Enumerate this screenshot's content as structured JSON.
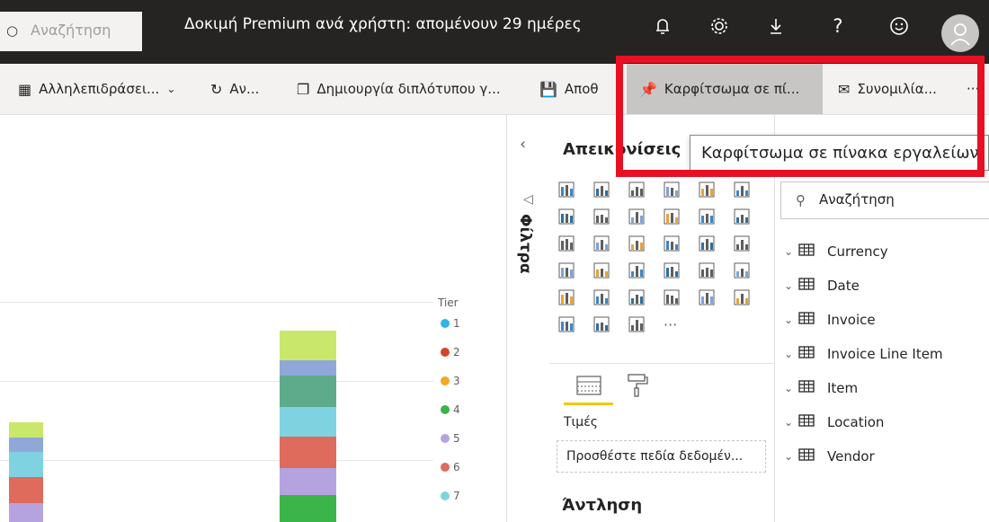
{
  "topbar": {
    "search_placeholder": "Αναζήτηση",
    "trial_text": "Δοκιμή Premium ανά χρήστη: απομένουν 29 ημέρες",
    "icons": [
      "bell-icon",
      "gear-icon",
      "download-icon",
      "help-icon",
      "smiley-icon"
    ]
  },
  "toolbar": {
    "interactions": "Αλληλεπιδράσει...",
    "refresh": "Αν...",
    "duplicate": "Δημιουργία διπλότυπου γ...",
    "save": "Αποθ",
    "pin": "Καρφίτσωμα σε πί...",
    "chat": "Συνομιλία...",
    "more": "···"
  },
  "tooltip": "Καρφίτσωμα σε πίνακα εργαλείων",
  "legend": {
    "title": "Tier",
    "items": [
      {
        "label": "1",
        "color": "#2fb5e8"
      },
      {
        "label": "2",
        "color": "#d64527"
      },
      {
        "label": "3",
        "color": "#f5a623"
      },
      {
        "label": "4",
        "color": "#3bb44a"
      },
      {
        "label": "5",
        "color": "#b5a3e0"
      },
      {
        "label": "6",
        "color": "#de6b5b"
      },
      {
        "label": "7",
        "color": "#7fd3e0"
      }
    ]
  },
  "filters": {
    "label": "Φίλτρα"
  },
  "visualizations": {
    "title": "Απεικονίσεις",
    "values_label": "Τιμές",
    "add_fields": "Προσθέστε πεδία δεδομέν...",
    "legend_label": "Άντληση",
    "more": "···"
  },
  "fields": {
    "search_placeholder": "Αναζήτηση",
    "tables": [
      "Currency",
      "Date",
      "Invoice",
      "Invoice Line Item",
      "Item",
      "Location",
      "Vendor"
    ]
  },
  "colors": {
    "topbar": "#252423",
    "toolbar": "#f3f2f1",
    "highlight_red": "#e81123",
    "accent_yellow": "#f2c811"
  }
}
